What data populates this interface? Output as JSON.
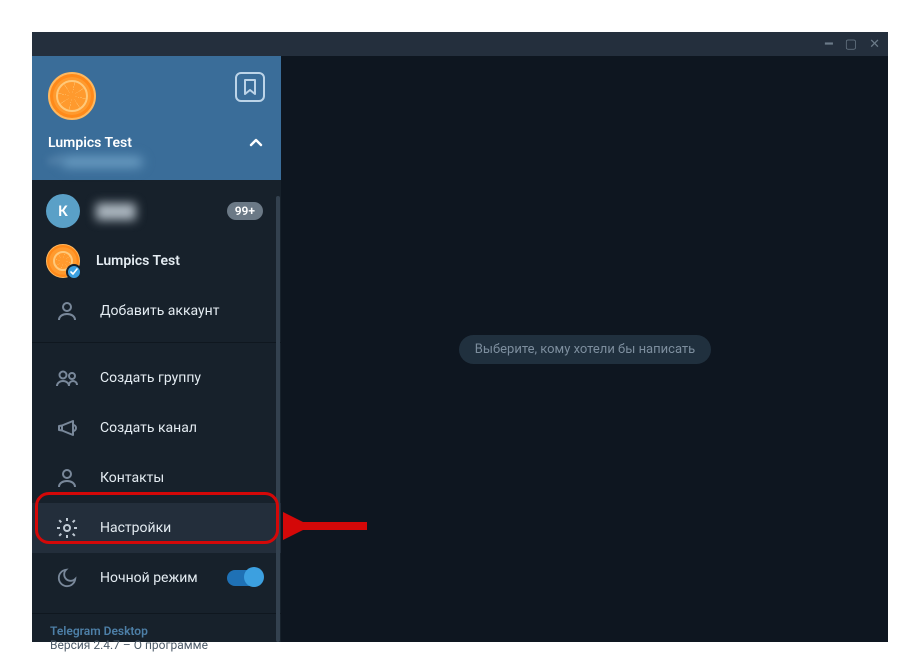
{
  "profile": {
    "name": "Lumpics Test",
    "phone_prefix": "+7"
  },
  "accounts": [
    {
      "initial": "К",
      "name": "",
      "badge": "99+"
    },
    {
      "name": "Lumpics Test"
    }
  ],
  "menu": {
    "add_account": "Добавить аккаунт",
    "new_group": "Создать группу",
    "new_channel": "Создать канал",
    "contacts": "Контакты",
    "settings": "Настройки",
    "night_mode": "Ночной режим"
  },
  "footer": {
    "app": "Telegram Desktop",
    "version_line": "Версия 2.4.7 – О программе"
  },
  "main": {
    "empty": "Выберите, кому хотели бы написать"
  }
}
